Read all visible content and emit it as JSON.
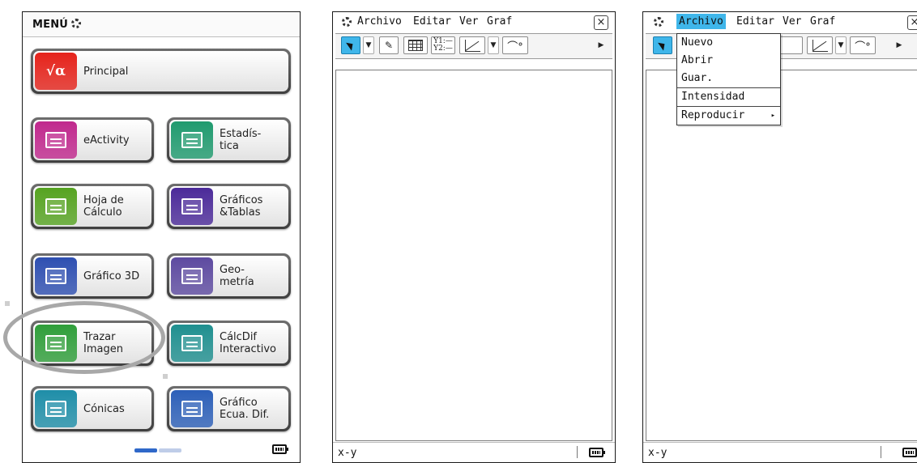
{
  "menu_screen": {
    "title": "MENÚ",
    "apps": [
      {
        "label": "Principal",
        "icon": "sqrt-alpha-icon",
        "icon_text": "√α",
        "color": "#e5231b",
        "frame": "#5a5a5a"
      },
      {
        "label": "eActivity",
        "icon": "eactivity-icon",
        "color": "#c0288d"
      },
      {
        "label": "Estadís-\ntica",
        "icon": "statistics-icon",
        "color": "#1f9a6e"
      },
      {
        "label": "Hoja de\nCálculo",
        "icon": "spreadsheet-icon",
        "color": "#56a321"
      },
      {
        "label": "Gráficos\n&Tablas",
        "icon": "graphs-tables-icon",
        "color": "#4b2a99"
      },
      {
        "label": "Gráfico 3D",
        "icon": "graph-3d-icon",
        "color": "#2e4fb1"
      },
      {
        "label": "Geo-\nmetría",
        "icon": "geometry-icon",
        "color": "#5d4aa0"
      },
      {
        "label": "Trazar\nImagen",
        "icon": "picture-plot-icon",
        "color": "#2f9e3a"
      },
      {
        "label": "CálcDif\nInteractivo",
        "icon": "differential-calc-icon",
        "color": "#1f8f8f"
      },
      {
        "label": "Cónicas",
        "icon": "conics-icon",
        "color": "#1f8ea8"
      },
      {
        "label": "Gráfico\nEcua. Dif.",
        "icon": "diff-eq-graph-icon",
        "color": "#2c5fb8"
      }
    ],
    "page_indicator": {
      "current": 1,
      "total": 2,
      "active_color": "#2f68c9",
      "inactive_color": "#bfcde8"
    }
  },
  "picture_plot_screen": {
    "menubar": [
      "Archivo",
      "Editar",
      "Ver",
      "Graf"
    ],
    "close": "×",
    "toolbar": {
      "y_labels": [
        "Y1:—",
        "Y2:—"
      ],
      "selected_color": "#3fb6ea"
    },
    "status": "x-y"
  },
  "menu_open_screen": {
    "menubar": [
      "Archivo",
      "Editar",
      "Ver",
      "Graf"
    ],
    "active_menu": "Archivo",
    "active_color": "#3fb6ea",
    "close": "×",
    "dropdown": [
      "Nuevo",
      "Abrir",
      "Guar.",
      "Intensidad",
      "Reproducir"
    ],
    "submenu_marker": "▸",
    "status": "x-y"
  }
}
